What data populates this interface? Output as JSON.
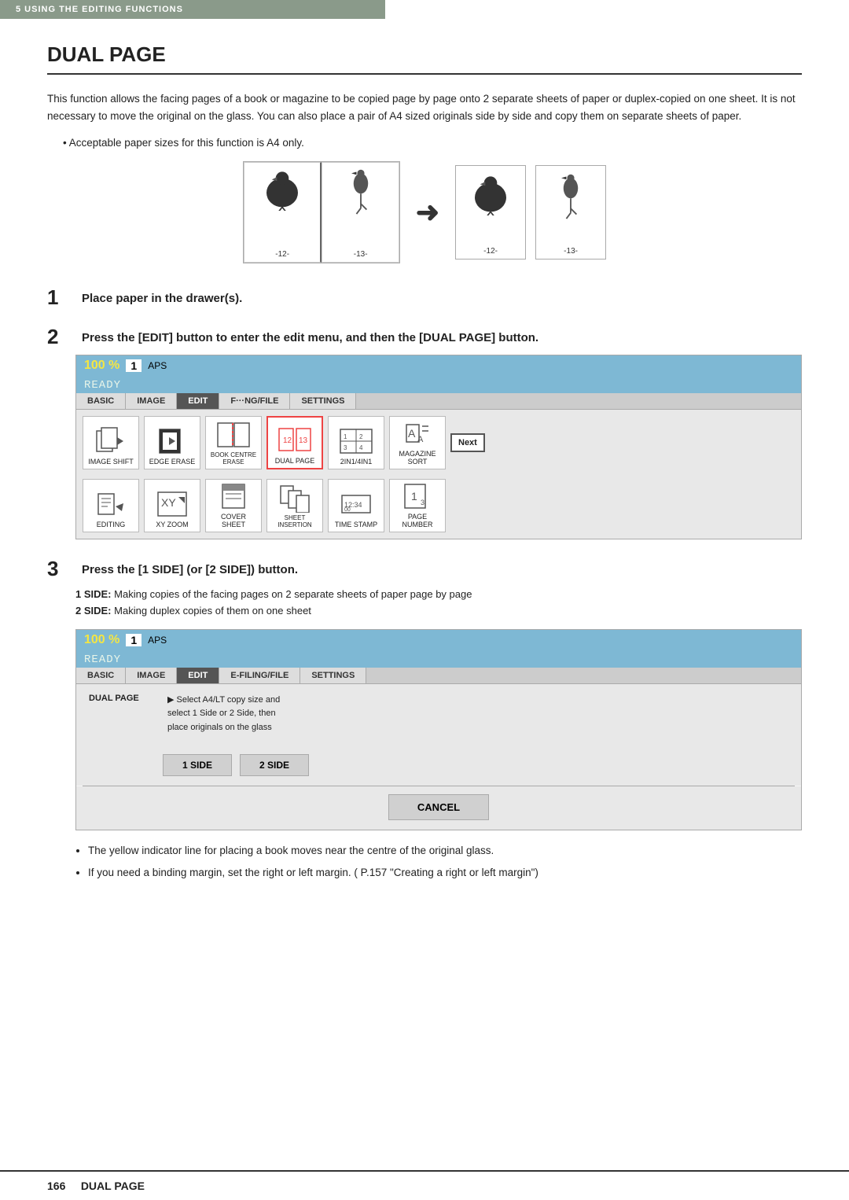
{
  "topBanner": "5   USING THE EDITING FUNCTIONS",
  "title": "DUAL PAGE",
  "description": "This function allows the facing pages of a book or magazine to be copied page by page onto 2 separate sheets of paper or duplex-copied on one sheet. It is not necessary to move the original on the glass. You can also place a pair of A4 sized originals side by side and copy them on separate sheets of paper.",
  "bulletNote": "Acceptable paper sizes for this function is A4 only.",
  "bookPages": {
    "left": "-12-",
    "right": "-13-"
  },
  "singlePages": [
    {
      "num": "-12-"
    },
    {
      "num": "-13-"
    }
  ],
  "steps": [
    {
      "number": "1",
      "text": "Place paper in the drawer(s)."
    },
    {
      "number": "2",
      "text": "Press the [EDIT] button to enter the edit menu, and then the [DUAL PAGE] button."
    },
    {
      "number": "3",
      "text": "Press the [1 SIDE] (or [2 SIDE]) button."
    }
  ],
  "statusBar": {
    "percent": "100",
    "percentSymbol": "%",
    "number": "1",
    "aps": "APS",
    "ready": "READY"
  },
  "tabs": [
    {
      "label": "BASIC",
      "active": false
    },
    {
      "label": "IMAGE",
      "active": false
    },
    {
      "label": "EDIT",
      "active": true
    },
    {
      "label": "F-LING/FILE",
      "active": false
    },
    {
      "label": "SETTINGS",
      "active": false
    }
  ],
  "tabs2": [
    {
      "label": "BASIC",
      "active": false
    },
    {
      "label": "IMAGE",
      "active": false
    },
    {
      "label": "EDIT",
      "active": true
    },
    {
      "label": "E-FILING/FILE",
      "active": false
    },
    {
      "label": "SETTINGS",
      "active": false
    }
  ],
  "editButtons": [
    {
      "label": "IMAGE SHIFT",
      "highlighted": false
    },
    {
      "label": "EDGE ERASE",
      "highlighted": false
    },
    {
      "label": "BOOK CENTRE ERASE",
      "highlighted": false
    },
    {
      "label": "DUAL PAGE",
      "highlighted": true
    },
    {
      "label": "2IN1/4IN1",
      "highlighted": false
    },
    {
      "label": "MAGAZINE SORT",
      "highlighted": false
    }
  ],
  "editButtons2": [
    {
      "label": "EDITING",
      "highlighted": false
    },
    {
      "label": "XY ZOOM",
      "highlighted": false
    },
    {
      "label": "COVER SHEET",
      "highlighted": false
    },
    {
      "label": "SHEET INSERTION",
      "highlighted": false
    },
    {
      "label": "TIME STAMP",
      "highlighted": false
    },
    {
      "label": "PAGE NUMBER",
      "highlighted": false
    }
  ],
  "nextButtonLabel": "Next",
  "panel2": {
    "dualPageLabel": "DUAL PAGE",
    "instruction": "▶ Select A4/LT copy size and\n   select 1 Side or 2 Side, then\n   place originals on the glass"
  },
  "sideButtons": [
    {
      "label": "1 SIDE"
    },
    {
      "label": "2 SIDE"
    }
  ],
  "cancelButton": "CANCEL",
  "stepNotes": [
    "The yellow indicator line for placing a book moves near the centre of the original glass.",
    "If you need a binding margin, set the right or left margin. (  P.157 \"Creating a right or left margin\")"
  ],
  "footer": {
    "pageNumber": "166",
    "label": "DUAL PAGE"
  }
}
